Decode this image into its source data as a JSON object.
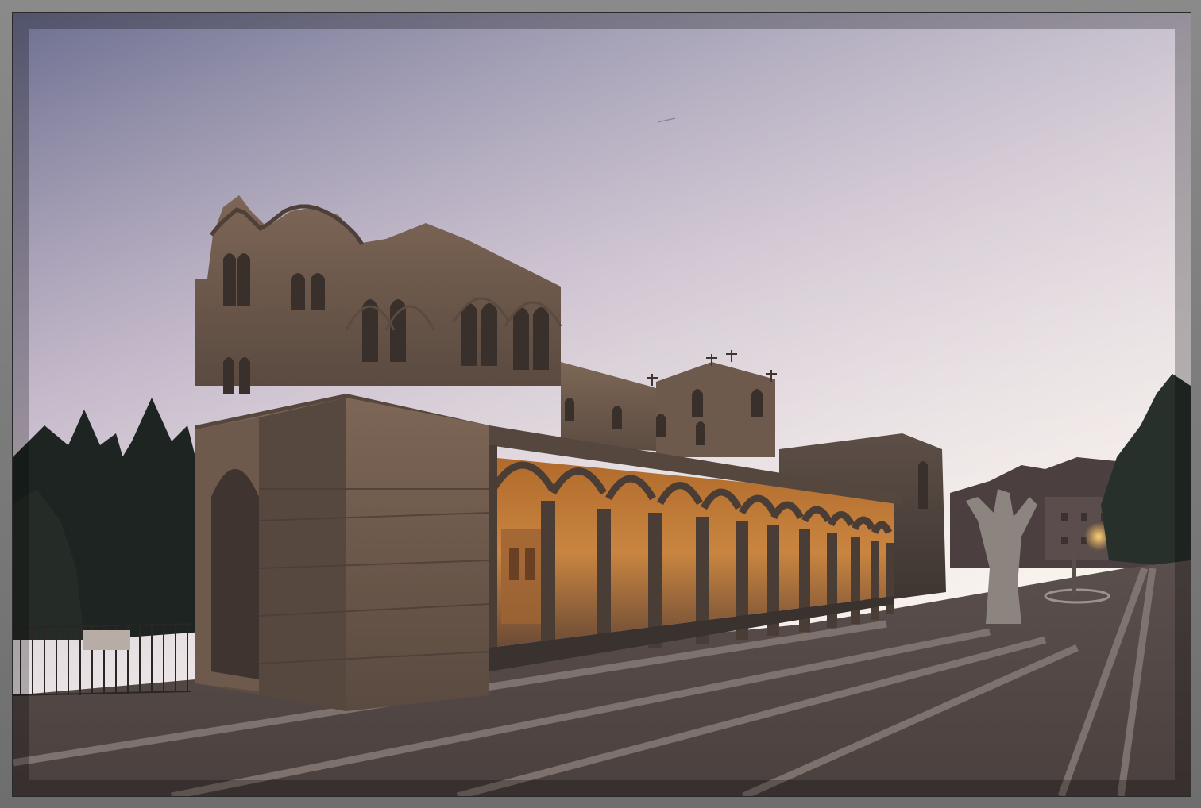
{
  "photo": {
    "subject": "romanesque-basilica-at-dusk",
    "colors": {
      "frame": "#7a7a7a",
      "sky_top": "#6f7292",
      "sky_mid": "#b9a9be",
      "sky_horizon": "#f4ede8",
      "stone_light": "#7a6555",
      "stone_dark": "#4a3d36",
      "arcade_glow": "#c07a35",
      "paving": "#5f5450",
      "paving_stripe": "#8a7f7b",
      "trees": "#1e2522"
    }
  }
}
